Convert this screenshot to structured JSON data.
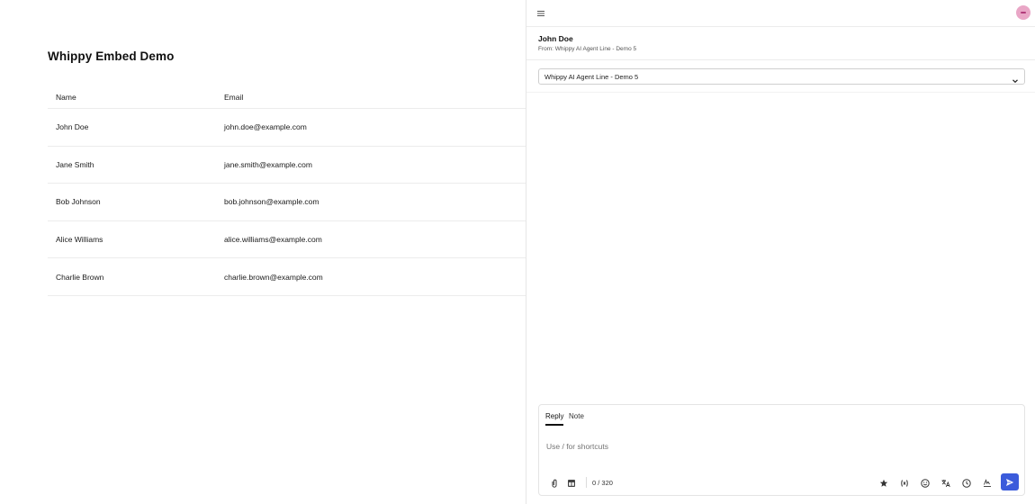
{
  "page": {
    "title": "Whippy Embed Demo",
    "table": {
      "headers": [
        "Name",
        "Email"
      ],
      "rows": [
        {
          "name": "John Doe",
          "email": "john.doe@example.com"
        },
        {
          "name": "Jane Smith",
          "email": "jane.smith@example.com"
        },
        {
          "name": "Bob Johnson",
          "email": "bob.johnson@example.com"
        },
        {
          "name": "Alice Williams",
          "email": "alice.williams@example.com"
        },
        {
          "name": "Charlie Brown",
          "email": "charlie.brown@example.com"
        }
      ]
    }
  },
  "panel": {
    "contact_name": "John Doe",
    "contact_from": "From: Whippy AI Agent Line - Demo 5",
    "line_selected": "Whippy AI Agent Line - Demo 5",
    "composer": {
      "tab_reply": "Reply",
      "tab_note": "Note",
      "placeholder": "Use / for shortcuts",
      "counter": "0 / 320"
    }
  },
  "colors": {
    "accent": "#3b5bdb",
    "avatar": "#e9a6c6"
  }
}
